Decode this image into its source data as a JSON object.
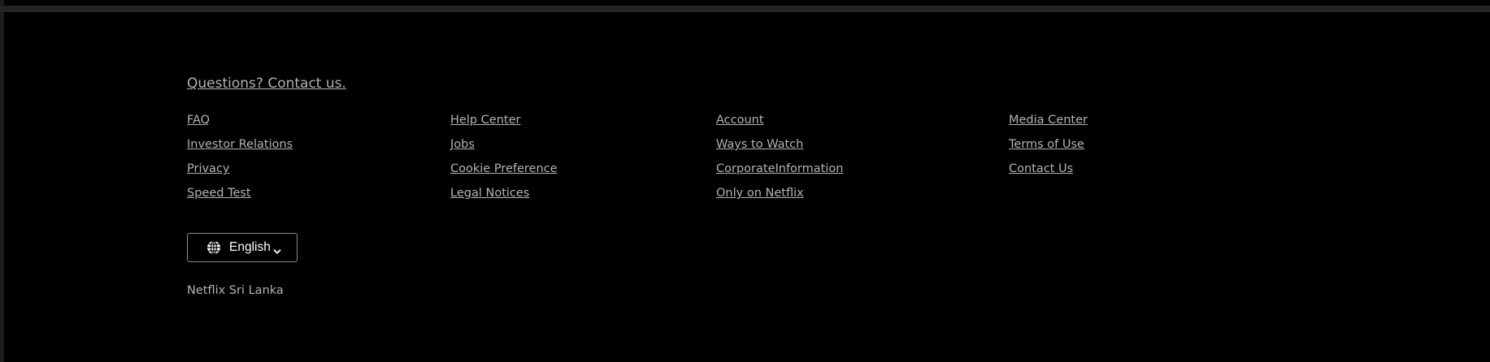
{
  "footer": {
    "questions_label": "Questions? Contact us.",
    "columns": [
      {
        "links": [
          "FAQ",
          "Investor Relations",
          "Privacy",
          "Speed Test"
        ]
      },
      {
        "links": [
          "Help Center",
          "Jobs",
          "Cookie Preference",
          "Legal Notices"
        ]
      },
      {
        "links": [
          "Account",
          "Ways to Watch",
          "CorporateInformation",
          "Only on Netflix"
        ]
      },
      {
        "links": [
          "Media Center",
          "Terms of Use",
          "Contact Us"
        ]
      }
    ],
    "language": {
      "icon": "globe-icon",
      "selected": "English",
      "chevron": "chevron-down-icon"
    },
    "country_label": "Netflix Sri Lanka"
  },
  "colors": {
    "background": "#000000",
    "link_text": "#b3b3b3",
    "button_border": "#8c8c8c",
    "button_text": "#ffffff"
  }
}
